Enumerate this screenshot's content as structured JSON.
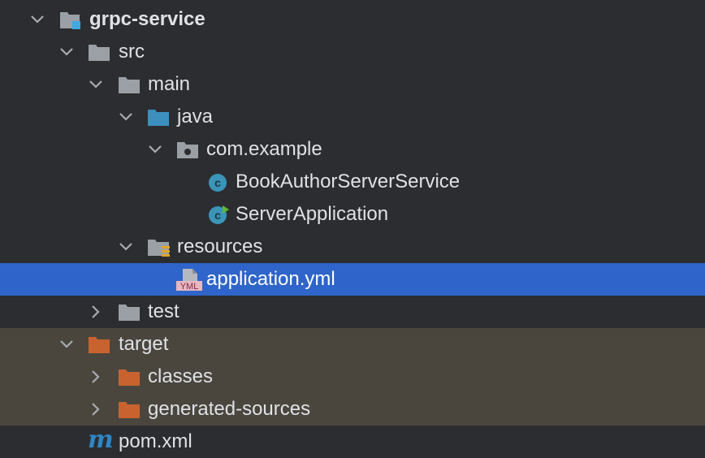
{
  "colors": {
    "background": "#2b2d30",
    "selected_row": "#2f65ca",
    "excluded_row": "#4a463e",
    "folder_gray": "#9aa0a6",
    "folder_blue": "#3d8fbd",
    "folder_orange": "#c8632f",
    "class_icon": "#3a95b8",
    "maven_icon": "#2f86c5"
  },
  "tree": {
    "project_label": "grpc-service",
    "src_label": "src",
    "main_label": "main",
    "java_label": "java",
    "package_label": "com.example",
    "class1_label": "BookAuthorServerService",
    "class2_label": "ServerApplication",
    "resources_label": "resources",
    "yml_label": "application.yml",
    "yml_icon_text": "YML",
    "test_label": "test",
    "target_label": "target",
    "classes_label": "classes",
    "generated_label": "generated-sources",
    "pom_label": "pom.xml",
    "pom_icon_text": "m"
  }
}
